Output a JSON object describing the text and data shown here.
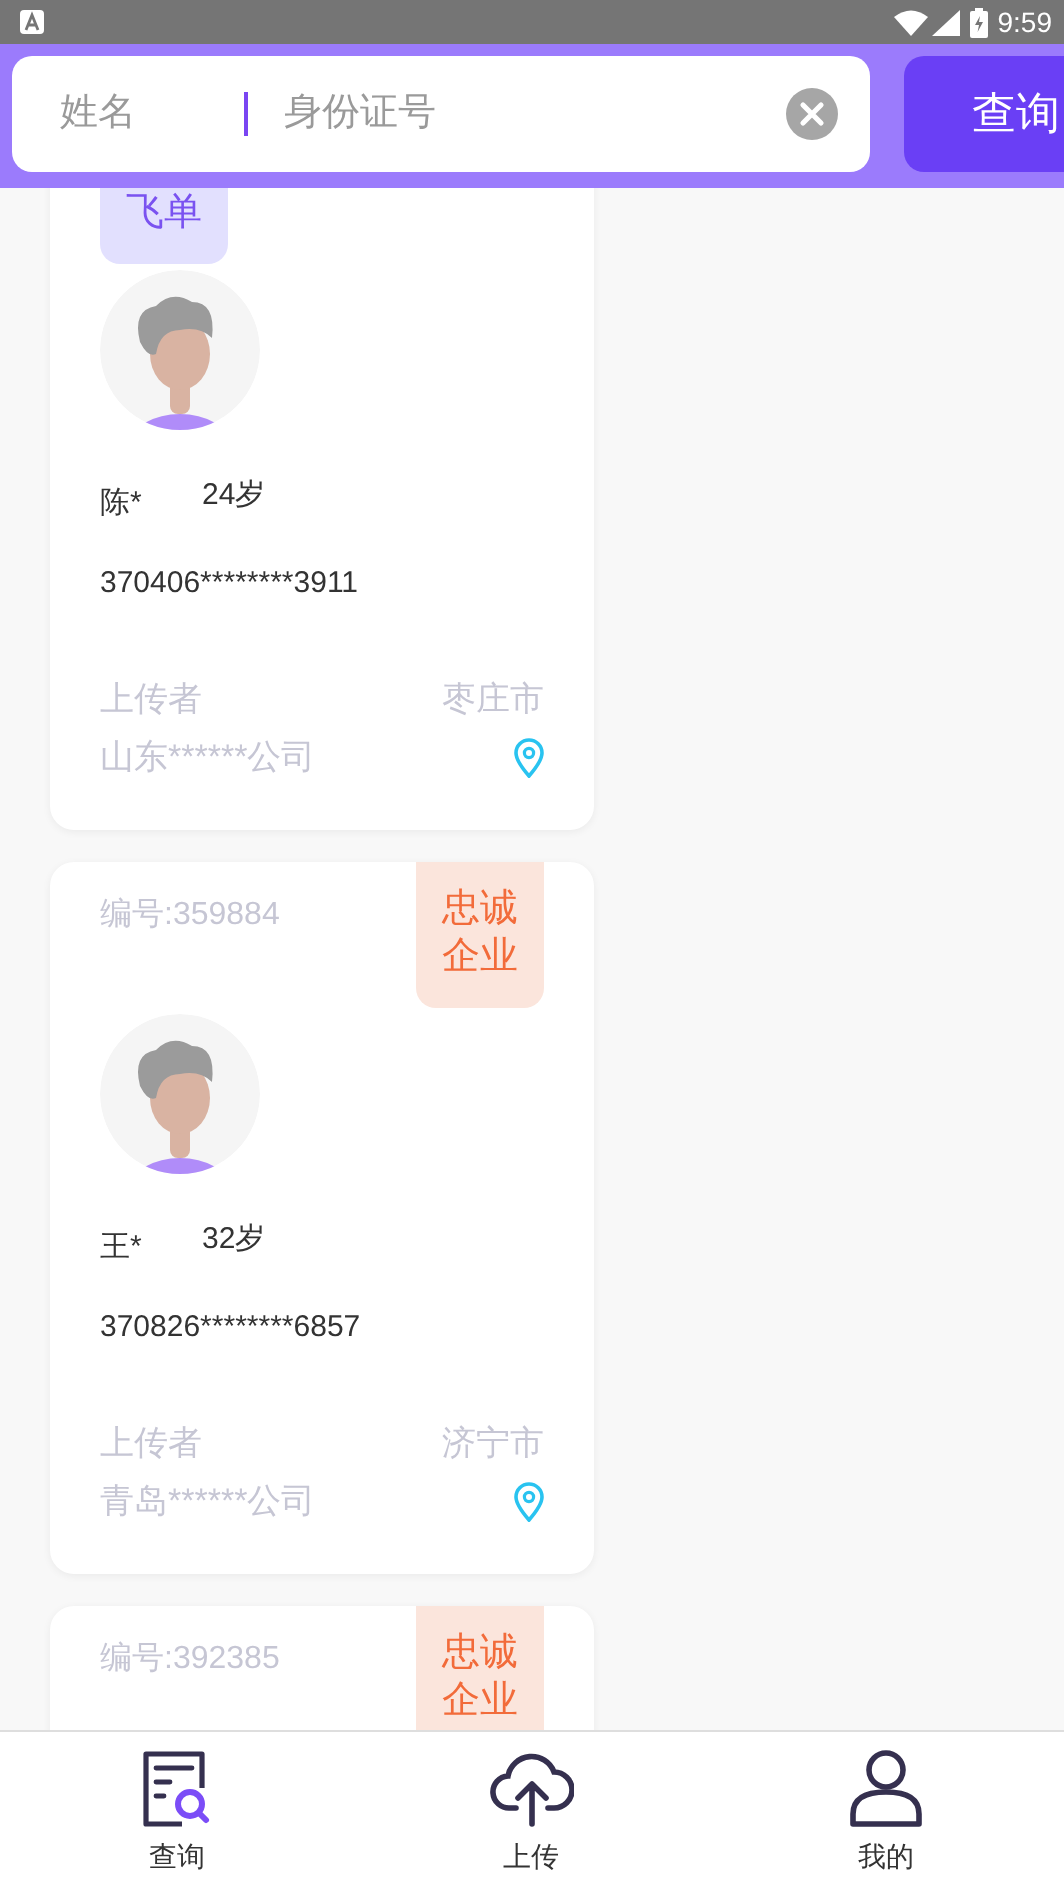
{
  "status_bar": {
    "time": "9:59"
  },
  "search": {
    "name_placeholder": "姓名",
    "id_placeholder": "身份证号",
    "button": "查询"
  },
  "cards": [
    {
      "badge": {
        "text": "飞单",
        "kind": "flyer"
      },
      "name": "陈*",
      "age": "24岁",
      "id_number": "370406********3911",
      "uploader_label": "上传者",
      "company": "山东******公司",
      "city": "枣庄市"
    },
    {
      "number": "编号:359884",
      "badge": {
        "text": "忠诚企业",
        "kind": "honest"
      },
      "name": "王*",
      "age": "32岁",
      "id_number": "370826********6857",
      "uploader_label": "上传者",
      "company": "青岛******公司",
      "city": "济宁市"
    },
    {
      "number": "编号:392385",
      "badge": {
        "text": "忠诚企业",
        "kind": "honest"
      }
    }
  ],
  "tabs": [
    {
      "label": "查询",
      "kind": "search-doc",
      "selected": true
    },
    {
      "label": "上传",
      "kind": "upload",
      "selected": false
    },
    {
      "label": "我的",
      "kind": "person",
      "selected": false
    }
  ]
}
